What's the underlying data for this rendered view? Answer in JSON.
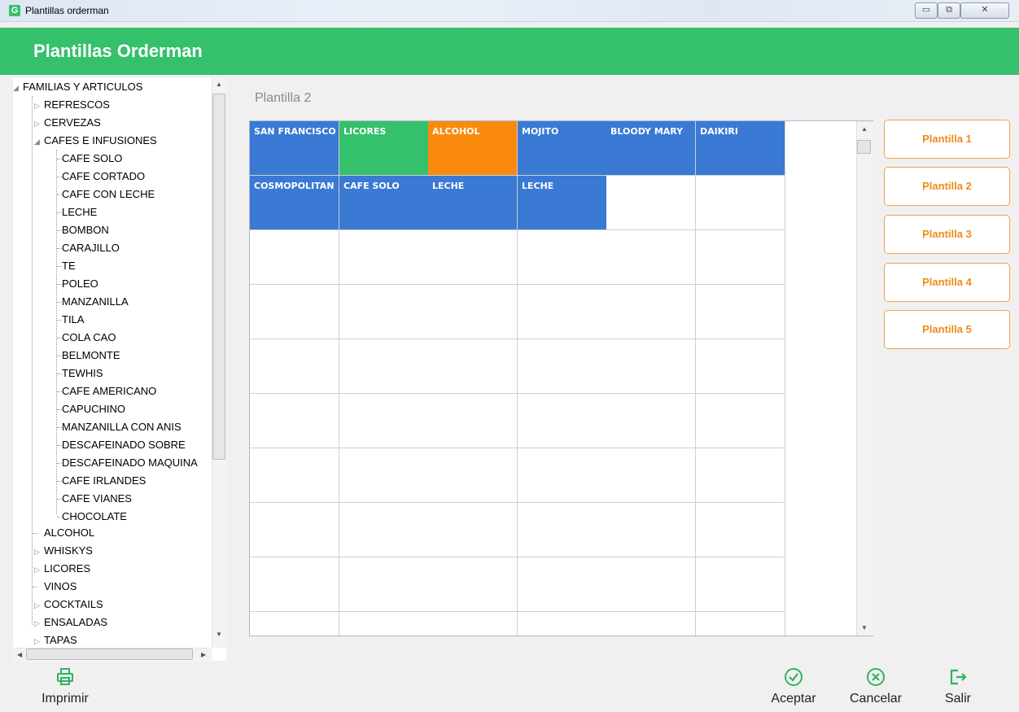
{
  "window": {
    "title": "Plantillas orderman",
    "icon_letter": "G",
    "minimize": "▭",
    "maximize": "⧉",
    "close": "✕"
  },
  "header": {
    "title": "Plantillas Orderman"
  },
  "colors": {
    "green": "#35c06c",
    "blue": "#3a79d4",
    "orange": "#f98a0e",
    "accent_orange": "#f08a1c"
  },
  "tree": {
    "root": "FAMILIAS Y ARTICULOS",
    "refrescos": "REFRESCOS",
    "cervezas": "CERVEZAS",
    "cafes": "CAFES E INFUSIONES",
    "cafes_items": [
      "CAFE SOLO",
      "CAFE CORTADO",
      "CAFE CON LECHE",
      "LECHE",
      "BOMBON",
      "CARAJILLO",
      "TE",
      "POLEO",
      "MANZANILLA",
      "TILA",
      "COLA CAO",
      "BELMONTE",
      "TEWHIS",
      "CAFE AMERICANO",
      "CAPUCHINO",
      "MANZANILLA CON ANIS",
      "DESCAFEINADO SOBRE",
      "DESCAFEINADO MAQUINA",
      "CAFE IRLANDES",
      "CAFE VIANES",
      "CHOCOLATE"
    ],
    "alcohol": "ALCOHOL",
    "whiskys": "WHISKYS",
    "licores": "LICORES",
    "vinos": "VINOS",
    "cocktails": "COCKTAILS",
    "ensaladas": "ENSALADAS",
    "tapas": "TAPAS"
  },
  "plantilla_label": "Plantilla 2",
  "grid": {
    "cells": [
      {
        "label": "SAN FRANCISCO",
        "color": "blue"
      },
      {
        "label": "LICORES",
        "color": "green"
      },
      {
        "label": "ALCOHOL",
        "color": "orange"
      },
      {
        "label": "MOJITO",
        "color": "blue"
      },
      {
        "label": "BLOODY MARY",
        "color": "blue"
      },
      {
        "label": "DAIKIRI",
        "color": "blue"
      },
      {
        "label": "COSMOPOLITAN",
        "color": "blue"
      },
      {
        "label": "CAFE SOLO",
        "color": "blue"
      },
      {
        "label": "LECHE",
        "color": "blue"
      },
      {
        "label": "LECHE",
        "color": "blue"
      }
    ]
  },
  "plantillas": [
    "Plantilla 1",
    "Plantilla 2",
    "Plantilla 3",
    "Plantilla 4",
    "Plantilla 5"
  ],
  "actions": {
    "print": "Imprimir",
    "accept": "Aceptar",
    "cancel": "Cancelar",
    "exit": "Salir"
  }
}
